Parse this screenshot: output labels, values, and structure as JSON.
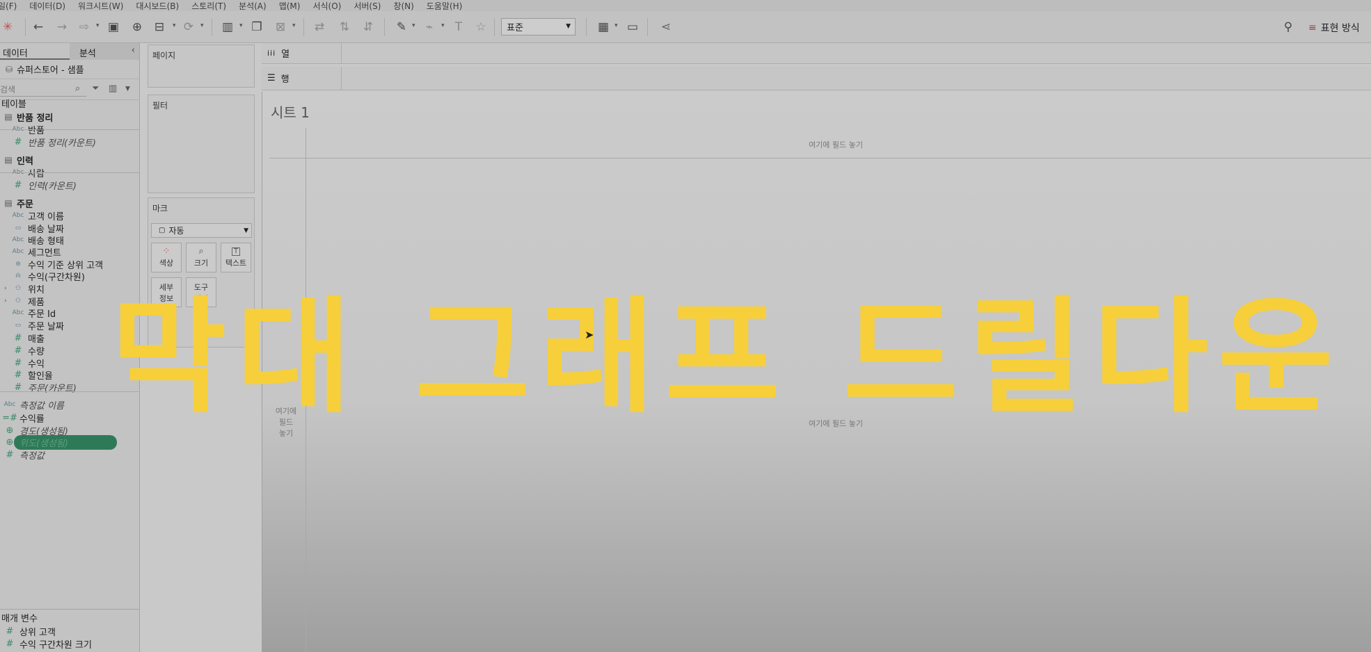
{
  "menu": [
    "일(F)",
    "데이터(D)",
    "워크시트(W)",
    "대시보드(B)",
    "스토리(T)",
    "분석(A)",
    "맵(M)",
    "서식(O)",
    "서버(S)",
    "창(N)",
    "도움말(H)"
  ],
  "toolbar": {
    "fit_value": "표준",
    "presentation_label": "표현 방식"
  },
  "data_pane": {
    "tab_data": "데이터",
    "tab_analysis": "분석",
    "source": "슈퍼스토어 - 샘플",
    "search_placeholder": "검색",
    "tables_header": "테이블",
    "fields": [
      {
        "type": "table",
        "label": "반품 정리"
      },
      {
        "type": "Abc",
        "label": "반품"
      },
      {
        "type": "#",
        "label": "반품 정리(카운트)",
        "italic": true
      },
      {
        "type": "table",
        "label": "인력"
      },
      {
        "type": "Abc",
        "label": "사람"
      },
      {
        "type": "#",
        "label": "인력(카운트)",
        "italic": true
      },
      {
        "type": "table",
        "label": "주문"
      },
      {
        "type": "Abc",
        "label": "고객 이름"
      },
      {
        "type": "date",
        "label": "배송 날짜"
      },
      {
        "type": "Abc",
        "label": "배송 형태"
      },
      {
        "type": "Abc",
        "label": "세그먼트"
      },
      {
        "type": "set",
        "label": "수익 기준 상위 고객"
      },
      {
        "type": "bin",
        "label": "수익(구간차원)"
      },
      {
        "type": "hier",
        "label": "위치"
      },
      {
        "type": "hier",
        "label": "제품"
      },
      {
        "type": "Abc",
        "label": "주문 Id"
      },
      {
        "type": "date",
        "label": "주문 날짜"
      },
      {
        "type": "#",
        "label": "매출"
      },
      {
        "type": "#",
        "label": "수량"
      },
      {
        "type": "#",
        "label": "수익"
      },
      {
        "type": "#",
        "label": "할인율"
      },
      {
        "type": "#",
        "label": "주문(카운트)",
        "italic": true
      },
      {
        "type": "Abc",
        "label": "측정값 이름",
        "italic": true
      },
      {
        "type": "calc",
        "label": "수익률"
      },
      {
        "type": "geo",
        "label": "경도(생성됨)",
        "italic": true
      },
      {
        "type": "geo",
        "label": "위도(생성됨)",
        "italic": true,
        "selected": true
      },
      {
        "type": "#",
        "label": "측정값",
        "italic": true
      }
    ],
    "params_header": "매개 변수",
    "params": [
      {
        "type": "#",
        "label": "상위 고객"
      },
      {
        "type": "#",
        "label": "수익 구간차원 크기"
      }
    ]
  },
  "cards": {
    "pages": "페이지",
    "filters": "필터",
    "marks": "마크",
    "marks_type": "자동",
    "mark_buttons": [
      "색상",
      "크기",
      "텍스트",
      "세부\n정보",
      "도구\n설명"
    ]
  },
  "shelves": {
    "columns": "열",
    "rows": "행"
  },
  "canvas": {
    "sheet_title": "시트 1",
    "drop_field_here": "여기에 필드 놓기",
    "row_drop": [
      "여기에",
      "필드",
      "놓기"
    ]
  },
  "overlay": {
    "title": "막대 그래프 드릴다운",
    "color": "#f6cf3b"
  }
}
